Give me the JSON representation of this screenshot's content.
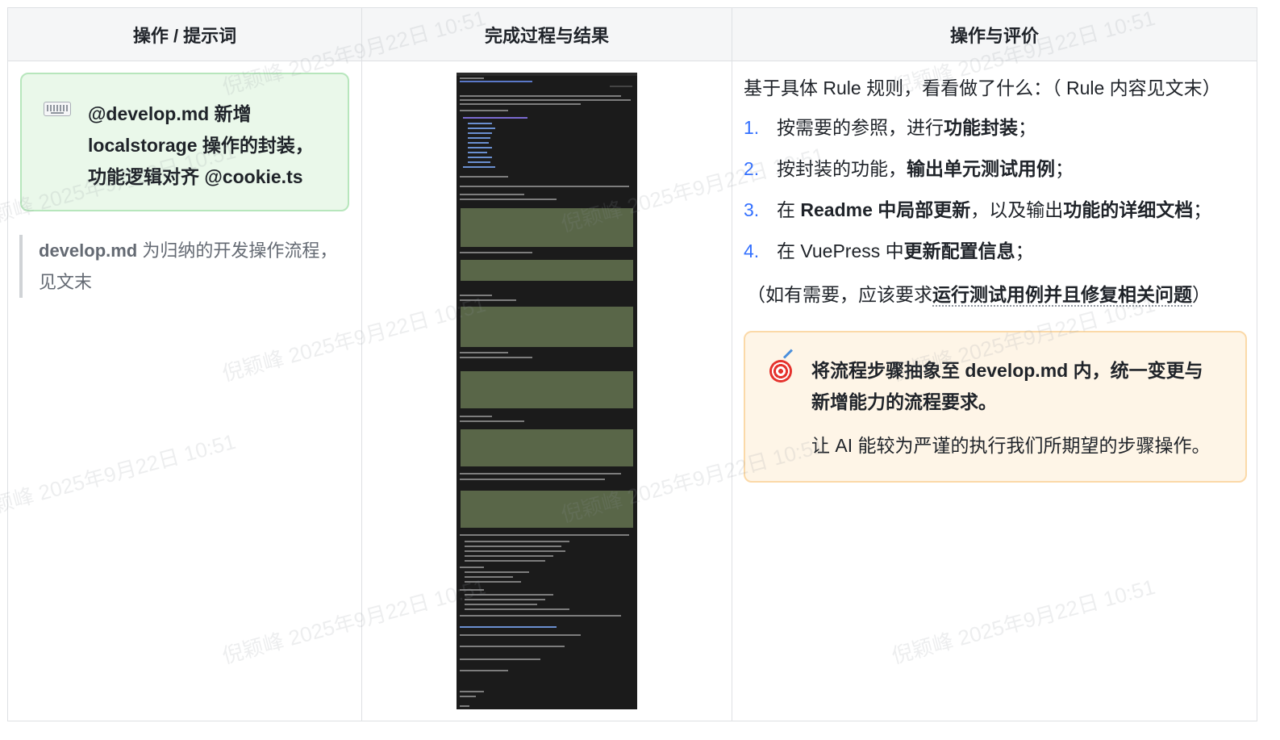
{
  "table": {
    "headers": [
      "操作 / 提示词",
      "完成过程与结果",
      "操作与评价"
    ]
  },
  "col1": {
    "prompt_callout": {
      "icon": "keyboard-icon",
      "line1": "@develop.md 新增",
      "line2": "localstorage 操作的封装，",
      "line3": "功能逻辑对齐 @cookie.ts"
    },
    "quote": {
      "bold": "develop.md",
      "text": " 为归纳的开发操作流程，见文末"
    }
  },
  "col2": {
    "screenshot_name": "completion-process-screenshot"
  },
  "col3": {
    "intro": "基于具体 Rule 规则，看看做了什么：（ Rule 内容见文末）",
    "steps": [
      {
        "num": "1.",
        "pre": "按需要的参照，进行",
        "bold": "功能封装",
        "post": "；",
        "bold2": "",
        "post2": ""
      },
      {
        "num": "2.",
        "pre": "按封装的功能，",
        "bold": "输出单元测试用例",
        "post": "；",
        "bold2": "",
        "post2": ""
      },
      {
        "num": "3.",
        "pre": "在 ",
        "bold": "Readme 中局部更新",
        "post": "，以及输出",
        "bold2": "功能的详细文档",
        "post2": "；"
      },
      {
        "num": "4.",
        "pre": "在 VuePress 中",
        "bold": "更新配置信息",
        "post": "；",
        "bold2": "",
        "post2": ""
      }
    ],
    "note": {
      "pre": "（如有需要，应该要求",
      "bold": "运行测试用例并且修复相关问题",
      "post": "）"
    },
    "callout": {
      "icon": "target-icon",
      "bold_line1": "将流程步骤抽象至 develop.md 内，统一变更与",
      "bold_line2": "新增能力的流程要求。",
      "text": "让 AI 能较为严谨的执行我们所期望的步骤操作。"
    }
  },
  "watermark": "倪颖峰 2025年9月22日 10:51"
}
